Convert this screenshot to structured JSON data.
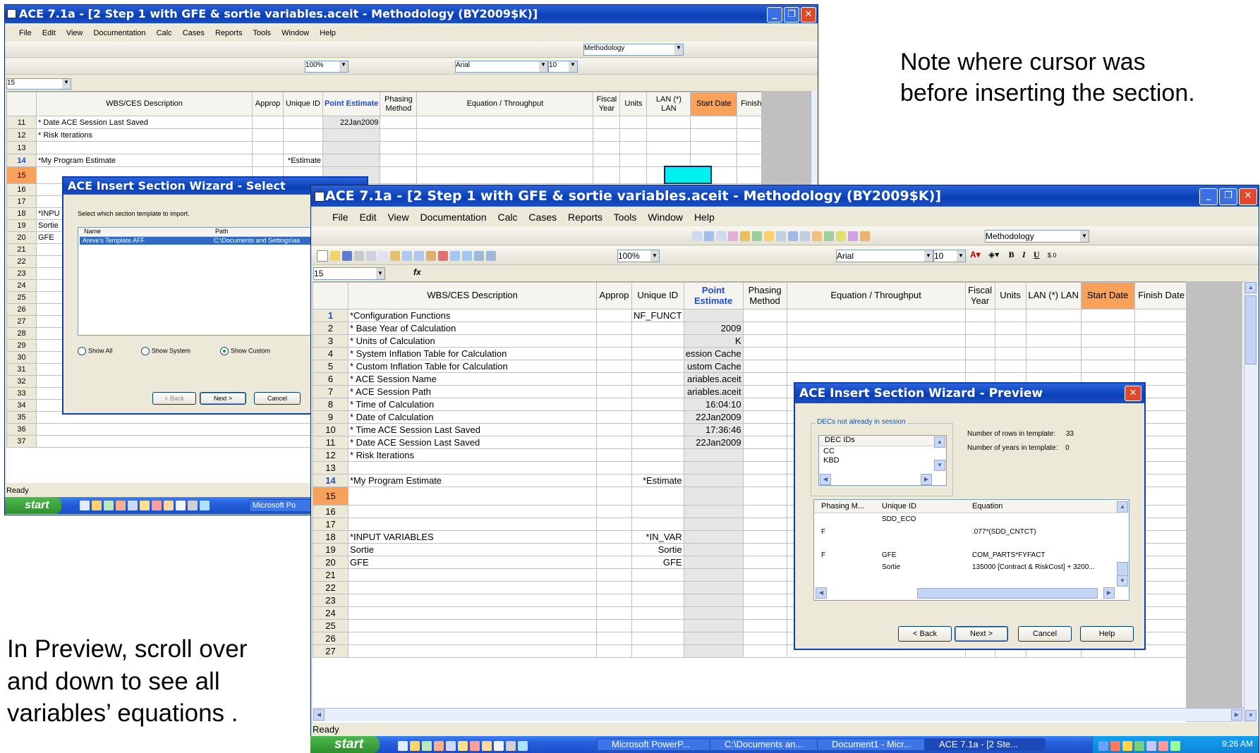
{
  "notes": {
    "cursor": "Note where cursor was before inserting the section.",
    "preview": "In Preview, scroll over and down to see all variables’ equations ."
  },
  "window_title": "ACE 7.1a - [2 Step 1 with GFE & sortie variables.aceit - Methodology (BY2009$K)]",
  "menu": [
    "File",
    "Edit",
    "View",
    "Documentation",
    "Calc",
    "Cases",
    "Reports",
    "Tools",
    "Window",
    "Help"
  ],
  "toolbar": {
    "view_combo": "Methodology",
    "zoom": "100%",
    "font": "Arial",
    "font_size": "10"
  },
  "back_window": {
    "name_box": "15",
    "status": "Ready",
    "row_numbers": [
      "11",
      "12",
      "13",
      "14",
      "15",
      "16",
      "17",
      "18",
      "19",
      "20",
      "21",
      "22",
      "23",
      "24",
      "25",
      "26",
      "27",
      "28",
      "29",
      "30",
      "31",
      "32",
      "33",
      "34",
      "35",
      "36",
      "37"
    ],
    "rows": [
      {
        "desc": "* Date ACE Session Last Saved",
        "uid": "",
        "pe": "22Jan2009"
      },
      {
        "desc": "* Risk Iterations",
        "uid": "",
        "pe": ""
      },
      {
        "desc": "",
        "uid": "",
        "pe": ""
      },
      {
        "desc": "*My Program Estimate",
        "uid": "*Estimate",
        "pe": ""
      },
      {
        "desc": "",
        "uid": "",
        "pe": ""
      }
    ],
    "partial_rows": [
      "*INPU",
      "Sortie",
      "GFE"
    ]
  },
  "columns": {
    "desc": "WBS/CES Description",
    "approp": "Approp",
    "uid": "Unique ID",
    "pe": "Point Estimate",
    "phasing": "Phasing Method",
    "equation": "Equation / Throughput",
    "fiscal": "Fiscal Year",
    "units": "Units",
    "lan": "LAN (*) LAN",
    "start": "Start Date",
    "finish": "Finish Date"
  },
  "select_dialog": {
    "title": "ACE Insert Section Wizard - Select",
    "instruction": "Select which section template to import.",
    "col_name": "Name",
    "col_path": "Path",
    "item_name": "Areve's Template.AFF",
    "item_path": "C:\\Documents and Settings\\aa",
    "radio_all": "Show All",
    "radio_system": "Show System",
    "radio_custom": "Show Custom",
    "back": "< Back",
    "next": "Next >",
    "cancel": "Cancel"
  },
  "front_window": {
    "name_box": "15",
    "status": "Ready",
    "rows": [
      {
        "n": "1",
        "desc": "*Configuration Functions",
        "uid": "NF_FUNCT",
        "pe": ""
      },
      {
        "n": "2",
        "desc": "* Base Year of Calculation",
        "uid": "",
        "pe": "2009"
      },
      {
        "n": "3",
        "desc": "* Units of Calculation",
        "uid": "",
        "pe": "K"
      },
      {
        "n": "4",
        "desc": "* System Inflation Table for Calculation",
        "uid": "",
        "pe": "ession Cache"
      },
      {
        "n": "5",
        "desc": "* Custom Inflation Table for Calculation",
        "uid": "",
        "pe": "ustom Cache"
      },
      {
        "n": "6",
        "desc": "* ACE Session Name",
        "uid": "",
        "pe": "ariables.aceit"
      },
      {
        "n": "7",
        "desc": "* ACE Session Path",
        "uid": "",
        "pe": "ariables.aceit"
      },
      {
        "n": "8",
        "desc": "* Time of Calculation",
        "uid": "",
        "pe": "16:04:10"
      },
      {
        "n": "9",
        "desc": "* Date of Calculation",
        "uid": "",
        "pe": "22Jan2009"
      },
      {
        "n": "10",
        "desc": "* Time ACE Session Last Saved",
        "uid": "",
        "pe": "17:36:46"
      },
      {
        "n": "11",
        "desc": "* Date ACE Session Last Saved",
        "uid": "",
        "pe": "22Jan2009"
      },
      {
        "n": "12",
        "desc": "* Risk Iterations",
        "uid": "",
        "pe": ""
      },
      {
        "n": "13",
        "desc": "",
        "uid": "",
        "pe": ""
      },
      {
        "n": "14",
        "desc": "*My Program Estimate",
        "uid": "*Estimate",
        "pe": ""
      },
      {
        "n": "15",
        "desc": "",
        "uid": "",
        "pe": ""
      },
      {
        "n": "16",
        "desc": "",
        "uid": "",
        "pe": ""
      },
      {
        "n": "17",
        "desc": "",
        "uid": "",
        "pe": ""
      },
      {
        "n": "18",
        "desc": "*INPUT VARIABLES",
        "uid": "*IN_VAR",
        "pe": ""
      },
      {
        "n": "19",
        "desc": "Sortie",
        "uid": "Sortie",
        "pe": ""
      },
      {
        "n": "20",
        "desc": "GFE",
        "uid": "GFE",
        "pe": ""
      },
      {
        "n": "21",
        "desc": "",
        "uid": "",
        "pe": ""
      },
      {
        "n": "22",
        "desc": "",
        "uid": "",
        "pe": ""
      },
      {
        "n": "23",
        "desc": "",
        "uid": "",
        "pe": ""
      },
      {
        "n": "24",
        "desc": "",
        "uid": "",
        "pe": ""
      },
      {
        "n": "25",
        "desc": "",
        "uid": "",
        "pe": ""
      },
      {
        "n": "26",
        "desc": "",
        "uid": "",
        "pe": ""
      },
      {
        "n": "27",
        "desc": "",
        "uid": "",
        "pe": ""
      }
    ]
  },
  "preview_dialog": {
    "title": "ACE Insert Section Wizard - Preview",
    "group_label": "DECs not already in session",
    "dec_header": "DEC IDs",
    "dec_items": [
      "CC",
      "KBD"
    ],
    "rows_label": "Number of rows in template:",
    "rows_value": "33",
    "years_label": "Number of years in template:",
    "years_value": "0",
    "col_phasing": "Phasing M...",
    "col_uid": "Unique ID",
    "col_eq": "Equation",
    "rows": [
      {
        "ph": "",
        "uid": "SDD_ECO",
        "eq": ""
      },
      {
        "ph": "F",
        "uid": "",
        "eq": ".077*(SDD_CNTCT)"
      },
      {
        "ph": "F",
        "uid": "GFE",
        "eq": "COM_PARTS*FYFACT"
      },
      {
        "ph": "",
        "uid": "Sortie",
        "eq": "135000 [Contract & RiskCost] + 3200..."
      }
    ],
    "back": "< Back",
    "next": "Next >",
    "cancel": "Cancel",
    "help": "Help"
  },
  "taskbar": {
    "start": "start",
    "tasks": [
      "Microsoft PowerP...",
      "C:\\Documents an...",
      "Document1 - Micr...",
      "ACE 7.1a - [2 Ste..."
    ],
    "back_task": "Microsoft Po",
    "clock": "9:26 AM"
  }
}
